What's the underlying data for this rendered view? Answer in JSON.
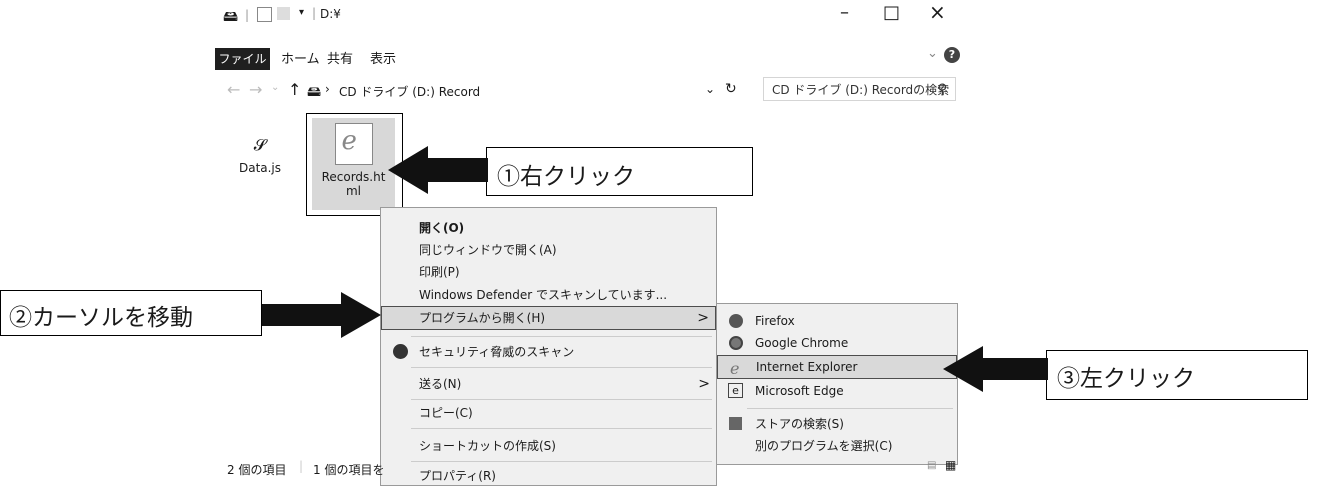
{
  "window": {
    "title": "D:¥",
    "title_sep": "|",
    "minimize": "–",
    "maximize": "□",
    "close": "×"
  },
  "ribbon": {
    "tabs": [
      "ファイル",
      "ホーム",
      "共有",
      "表示"
    ],
    "help": "?",
    "expand": "⌄"
  },
  "address": {
    "path_drive": "CD ドライブ (D:) Record",
    "separator": "›",
    "search_placeholder": "CD ドライブ (D:) Recordの検索"
  },
  "files": [
    {
      "name": "Data.js",
      "icon": "script-file-icon"
    },
    {
      "name": "Records.ht ml",
      "icon": "ie-html-icon"
    }
  ],
  "context_menu": {
    "items": [
      {
        "label": "開く(O)",
        "bold": true
      },
      {
        "label": "同じウィンドウで開く(A)"
      },
      {
        "label": "印刷(P)"
      },
      {
        "label": "Windows Defender でスキャンしています..."
      },
      {
        "label": "プログラムから開く(H)",
        "submenu": true,
        "highlighted": true
      },
      {
        "label": "セキュリティ脅威のスキャン",
        "icon": "security-scan-icon"
      },
      {
        "label": "送る(N)",
        "submenu": true
      },
      {
        "label": "コピー(C)"
      },
      {
        "label": "ショートカットの作成(S)"
      },
      {
        "label": "プロパティ(R)"
      }
    ],
    "submenu_arrow": ">"
  },
  "open_with_menu": {
    "items": [
      {
        "label": "Firefox",
        "icon": "firefox-icon"
      },
      {
        "label": "Google Chrome",
        "icon": "chrome-icon"
      },
      {
        "label": "Internet Explorer",
        "icon": "ie-icon",
        "highlighted": true
      },
      {
        "label": "Microsoft Edge",
        "icon": "edge-icon"
      },
      {
        "label": "ストアの検索(S)",
        "icon": "store-icon"
      },
      {
        "label": "別のプログラムを選択(C)"
      }
    ]
  },
  "status": {
    "item_count": "2 個の項目",
    "selected": "1 個の項目を"
  },
  "callouts": {
    "step1": "①右クリック",
    "step2": "②カーソルを移動",
    "step3": "③左クリック"
  }
}
